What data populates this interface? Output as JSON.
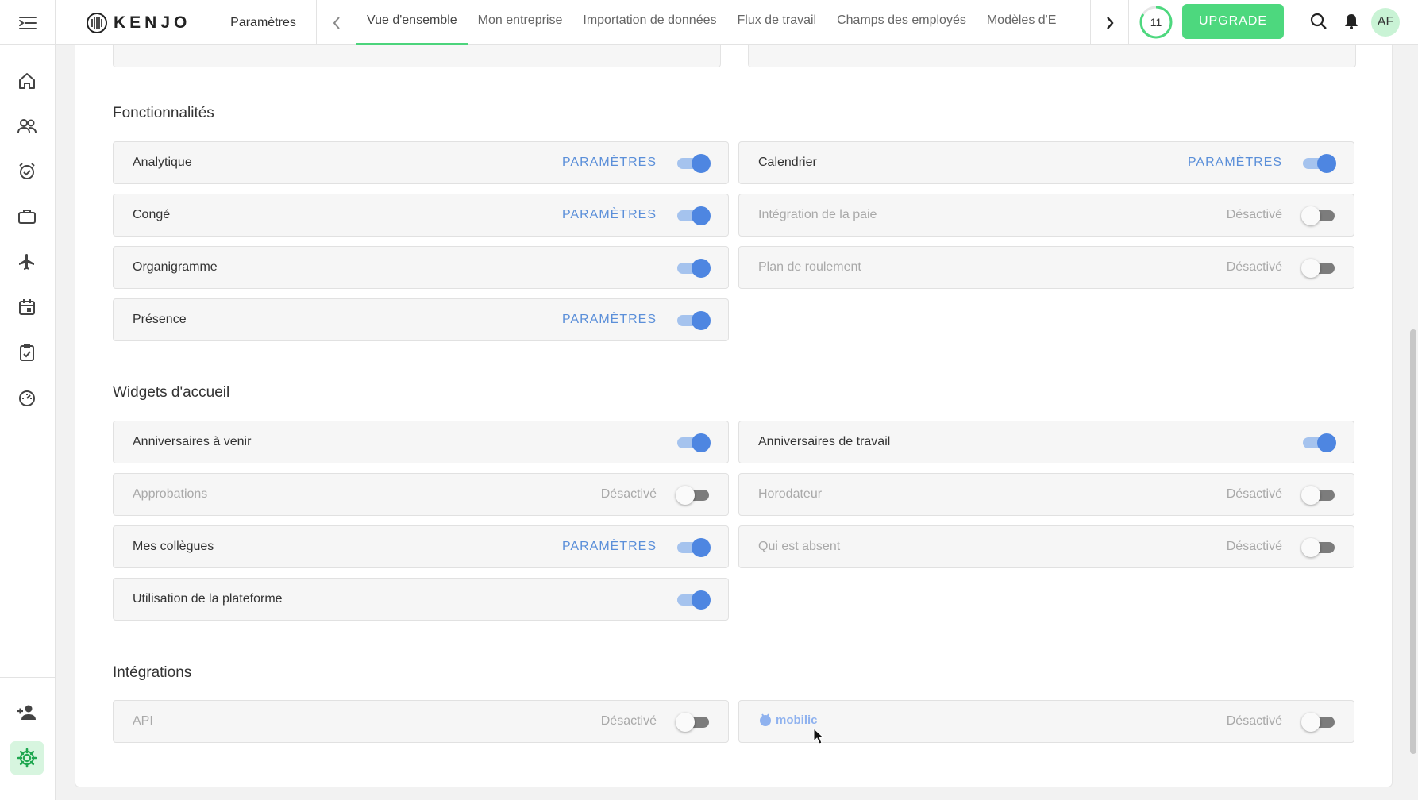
{
  "header": {
    "logo_text": "KENJO",
    "breadcrumb": "Paramètres",
    "tabs": [
      {
        "label": "Vue d'ensemble",
        "active": true
      },
      {
        "label": "Mon entreprise"
      },
      {
        "label": "Importation de données"
      },
      {
        "label": "Flux de travail"
      },
      {
        "label": "Champs des employés"
      },
      {
        "label": "Modèles d'E"
      }
    ],
    "progress_value": "11",
    "upgrade_label": "UPGRADE",
    "avatar_initials": "AF"
  },
  "sidebar": {
    "items": [
      {
        "icon": "home-icon"
      },
      {
        "icon": "people-icon"
      },
      {
        "icon": "alarm-clock-icon"
      },
      {
        "icon": "briefcase-icon"
      },
      {
        "icon": "airplane-icon"
      },
      {
        "icon": "calendar-icon"
      },
      {
        "icon": "checklist-icon"
      },
      {
        "icon": "speedometer-icon"
      }
    ],
    "bottom_items": [
      {
        "icon": "add-person-icon"
      },
      {
        "icon": "gear-icon",
        "active": true
      }
    ]
  },
  "sections": {
    "features": {
      "title": "Fonctionnalités",
      "items": [
        {
          "label": "Analytique",
          "action": "PARAMÈTRES",
          "enabled": true
        },
        {
          "label": "Calendrier",
          "action": "PARAMÈTRES",
          "enabled": true
        },
        {
          "label": "Congé",
          "action": "PARAMÈTRES",
          "enabled": true
        },
        {
          "label": "Intégration de la paie",
          "status": "Désactivé",
          "enabled": false
        },
        {
          "label": "Organigramme",
          "enabled": true
        },
        {
          "label": "Plan de roulement",
          "status": "Désactivé",
          "enabled": false
        },
        {
          "label": "Présence",
          "action": "PARAMÈTRES",
          "enabled": true
        }
      ]
    },
    "widgets": {
      "title": "Widgets d'accueil",
      "items": [
        {
          "label": "Anniversaires à venir",
          "enabled": true
        },
        {
          "label": "Anniversaires de travail",
          "enabled": true
        },
        {
          "label": "Approbations",
          "status": "Désactivé",
          "enabled": false
        },
        {
          "label": "Horodateur",
          "status": "Désactivé",
          "enabled": false
        },
        {
          "label": "Mes collègues",
          "action": "PARAMÈTRES",
          "enabled": true
        },
        {
          "label": "Qui est absent",
          "status": "Désactivé",
          "enabled": false
        },
        {
          "label": "Utilisation de la plateforme",
          "enabled": true
        }
      ]
    },
    "integrations": {
      "title": "Intégrations",
      "items": [
        {
          "label": "API",
          "status": "Désactivé",
          "enabled": false
        },
        {
          "label": "mobilic",
          "status": "Désactivé",
          "enabled": false
        }
      ]
    }
  },
  "colors": {
    "accent_green": "#4dd87e",
    "toggle_on": "#4e86e1",
    "link_blue": "#5b8fd9"
  }
}
